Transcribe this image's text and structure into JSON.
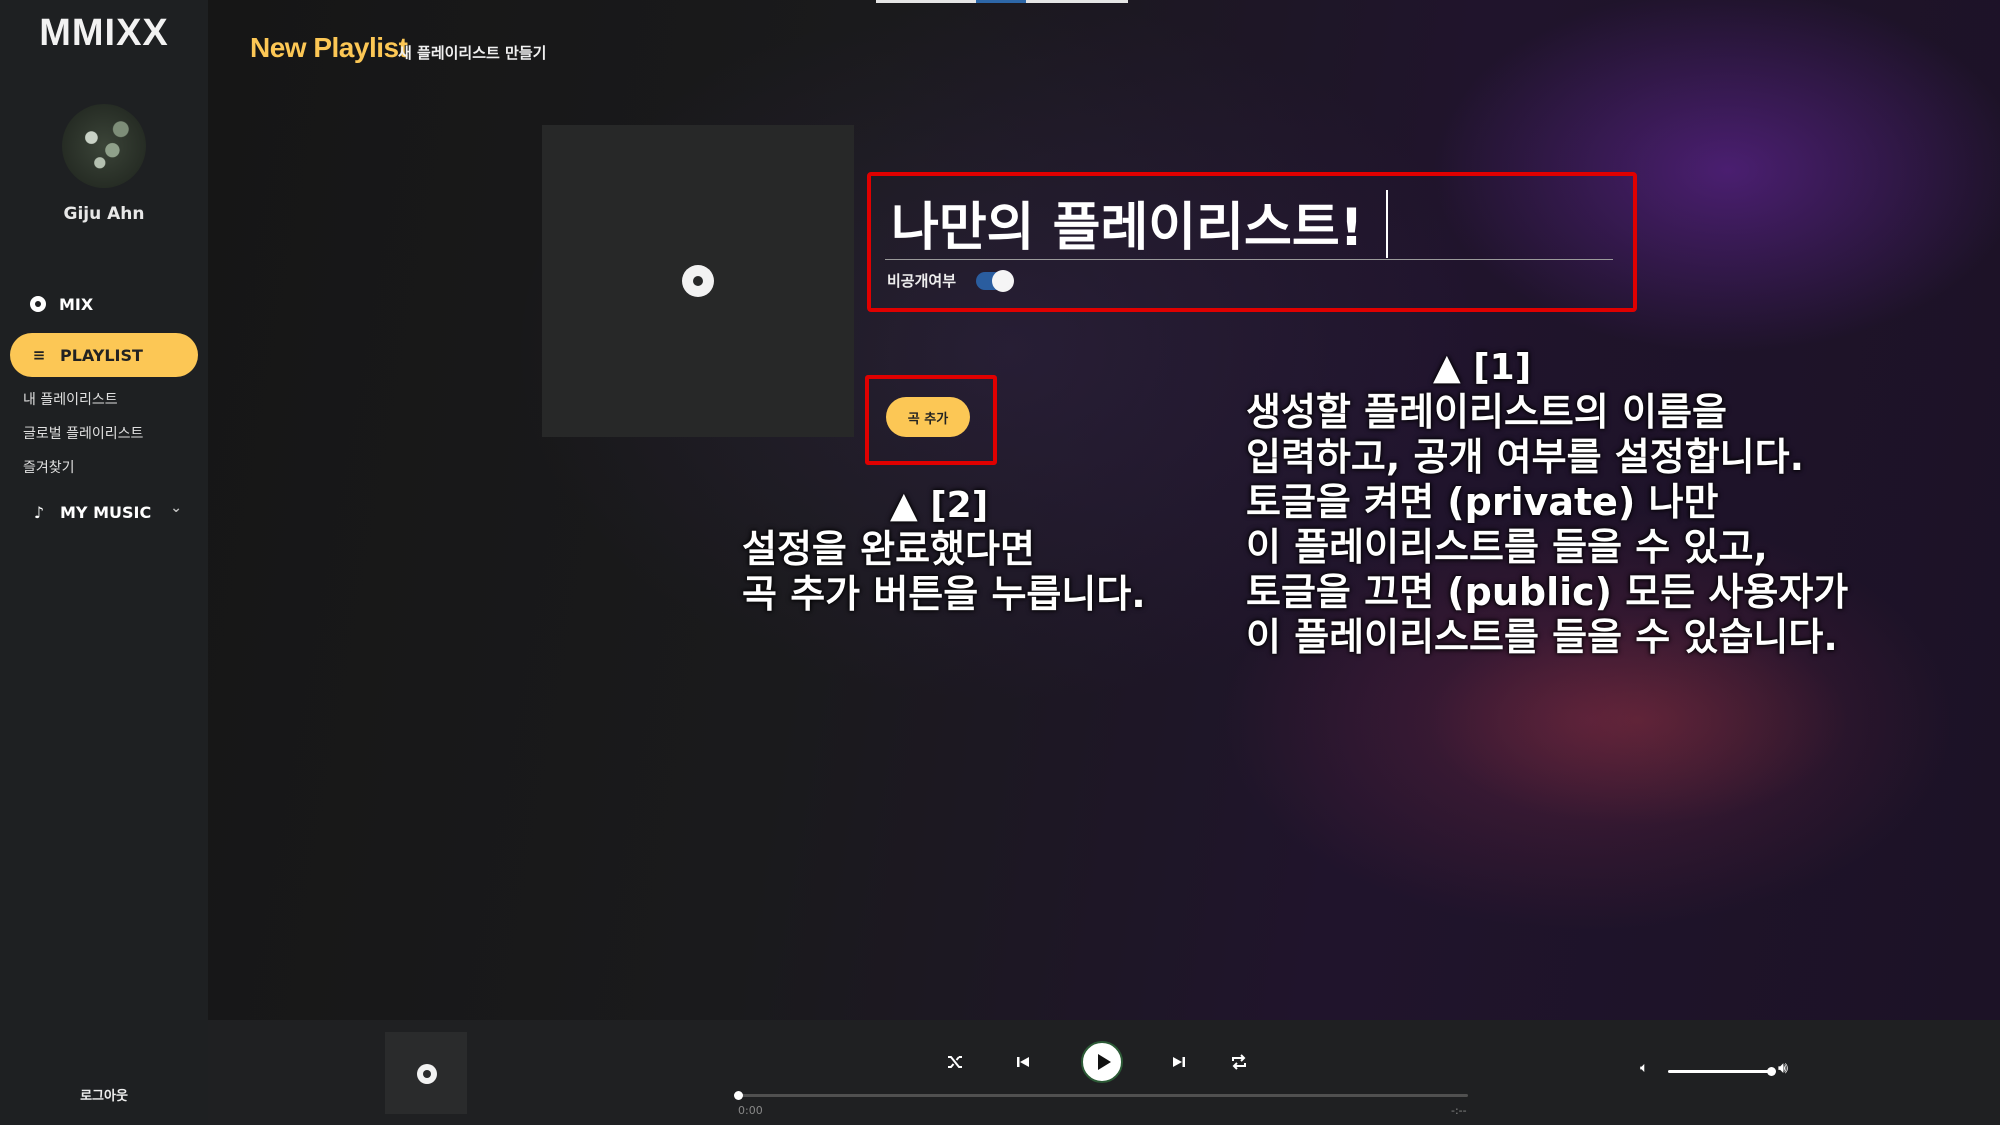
{
  "app": {
    "logo": "MMIXX",
    "user_name": "Giju Ahn",
    "logout": "로그아웃"
  },
  "sidebar": {
    "mix_label": "MIX",
    "playlist_label": "PLAYLIST",
    "playlist_sub": [
      "내 플레이리스트",
      "글로벌 플레이리스트",
      "즐겨찾기"
    ],
    "mymusic_label": "MY MUSIC"
  },
  "page": {
    "title": "New Playlist",
    "subtitle": "새 플레이리스트 만들기"
  },
  "form": {
    "playlist_name": "나만의 플레이리스트!",
    "private_label": "비공개여부",
    "private_on": true,
    "add_song_button": "곡 추가"
  },
  "annotations": {
    "one_marker": "▲ [1]",
    "one_text": "생성할 플레이리스트의 이름을\n입력하고, 공개 여부를 설정합니다.\n토글을 켜면 (private) 나만\n이 플레이리스트를 들을 수 있고,\n토글을 끄면 (public) 모든 사용자가\n이 플레이리스트를 들을 수 있습니다.",
    "two_marker": "▲ [2]",
    "two_text": "설정을 완료했다면\n곡 추가 버튼을 누릅니다."
  },
  "player": {
    "time_current": "0:00",
    "time_total": "-:--",
    "progress": 0,
    "volume": 1.0
  },
  "colors": {
    "accent": "#fcc755",
    "annotation_border": "#e00000",
    "toggle": "#2a5d9f"
  }
}
